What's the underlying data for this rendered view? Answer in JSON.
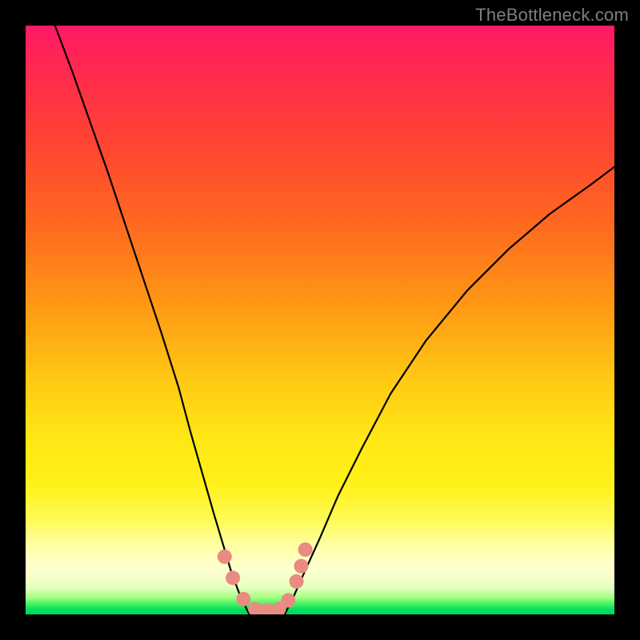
{
  "watermark": "TheBottleneck.com",
  "chart_data": {
    "type": "line",
    "title": "",
    "xlabel": "",
    "ylabel": "",
    "xlim": [
      0,
      100
    ],
    "ylim": [
      0,
      100
    ],
    "grid": false,
    "legend": false,
    "background_gradient": {
      "direction": "vertical",
      "stops": [
        {
          "pos": 0.0,
          "color": "#ff1a66"
        },
        {
          "pos": 0.2,
          "color": "#ff4433"
        },
        {
          "pos": 0.48,
          "color": "#ff9a14"
        },
        {
          "pos": 0.7,
          "color": "#ffe714"
        },
        {
          "pos": 0.88,
          "color": "#ffffa0"
        },
        {
          "pos": 0.97,
          "color": "#a0ff80"
        },
        {
          "pos": 1.0,
          "color": "#00d858"
        }
      ]
    },
    "series": [
      {
        "name": "left-branch",
        "mode": "line",
        "color": "#000000",
        "width": 2.2,
        "x": [
          5,
          8,
          11,
          14,
          17,
          20,
          23,
          26,
          28,
          30,
          32,
          33.5,
          35,
          36.5,
          38
        ],
        "y": [
          100,
          92,
          83.5,
          75,
          66,
          57,
          48,
          38.5,
          31,
          24,
          17,
          12,
          7,
          3,
          0
        ]
      },
      {
        "name": "right-branch",
        "mode": "line",
        "color": "#000000",
        "width": 2.2,
        "x": [
          44,
          45.5,
          47.5,
          50,
          53,
          57,
          62,
          68,
          75,
          82,
          89,
          96,
          100
        ],
        "y": [
          0,
          3,
          7.5,
          13,
          20,
          28,
          37.5,
          46.5,
          55,
          62,
          68,
          73,
          76
        ]
      },
      {
        "name": "valley-markers",
        "mode": "scatter",
        "color": "#e98b82",
        "radius": 9,
        "x": [
          33.8,
          35.2,
          37.0,
          39.0,
          41.0,
          43.0,
          44.6,
          46.0,
          46.8,
          47.5
        ],
        "y": [
          9.8,
          6.2,
          2.6,
          0.9,
          0.7,
          0.9,
          2.4,
          5.6,
          8.2,
          11.0
        ]
      }
    ]
  }
}
